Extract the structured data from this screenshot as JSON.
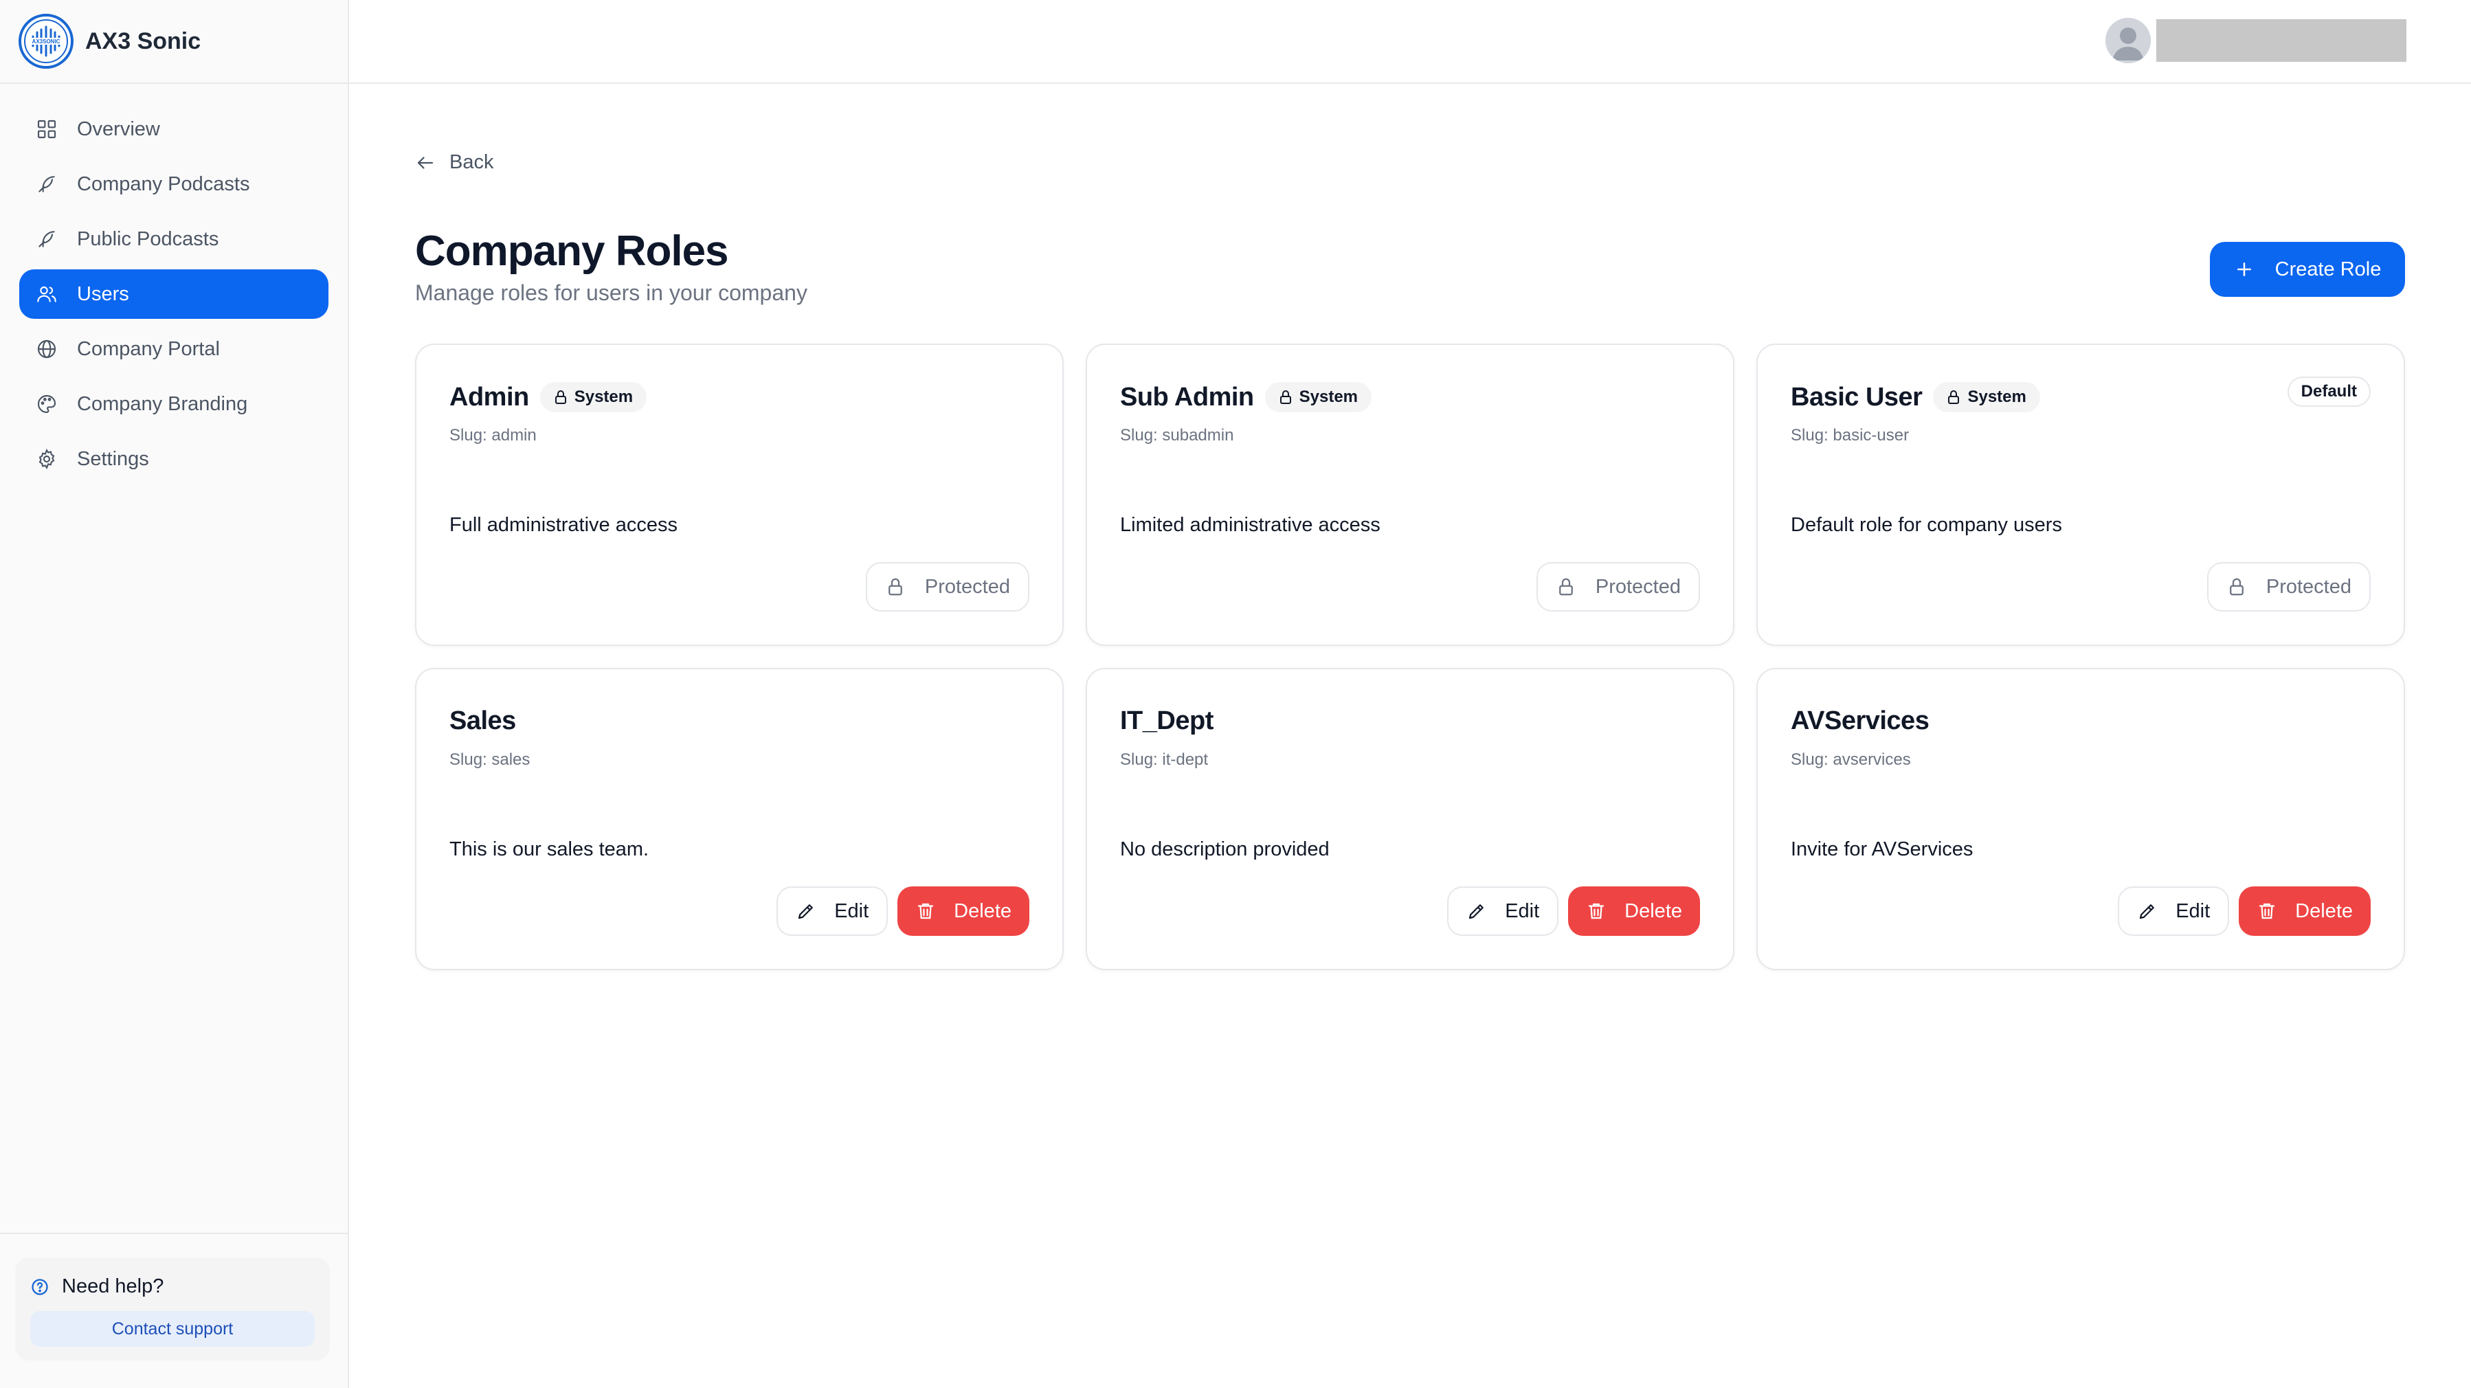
{
  "app": {
    "name": "AX3 Sonic",
    "logo_text": "AX3SONIC"
  },
  "sidebar": {
    "items": [
      {
        "label": "Overview",
        "icon": "grid-icon"
      },
      {
        "label": "Company Podcasts",
        "icon": "feather-icon"
      },
      {
        "label": "Public Podcasts",
        "icon": "feather-icon"
      },
      {
        "label": "Users",
        "icon": "users-icon",
        "active": true
      },
      {
        "label": "Company Portal",
        "icon": "globe-icon"
      },
      {
        "label": "Company Branding",
        "icon": "palette-icon"
      },
      {
        "label": "Settings",
        "icon": "gear-icon"
      }
    ],
    "help": {
      "title": "Need help?",
      "button": "Contact support"
    }
  },
  "header": {
    "user_name": ""
  },
  "page": {
    "back_label": "Back",
    "title": "Company Roles",
    "subtitle": "Manage roles for users in your company",
    "create_label": "Create Role"
  },
  "roles": [
    {
      "name": "Admin",
      "system": true,
      "system_label": "System",
      "slug": "Slug: admin",
      "description": "Full administrative access",
      "protected_label": "Protected"
    },
    {
      "name": "Sub Admin",
      "system": true,
      "system_label": "System",
      "slug": "Slug: subadmin",
      "description": "Limited administrative access",
      "protected_label": "Protected"
    },
    {
      "name": "Basic User",
      "system": true,
      "system_label": "System",
      "default_label": "Default",
      "slug": "Slug: basic-user",
      "description": "Default role for company users",
      "protected_label": "Protected"
    },
    {
      "name": "Sales",
      "system": false,
      "slug": "Slug: sales",
      "description": "This is our sales team.",
      "edit_label": "Edit",
      "delete_label": "Delete"
    },
    {
      "name": "IT_Dept",
      "system": false,
      "slug": "Slug: it-dept",
      "description": "No description provided",
      "edit_label": "Edit",
      "delete_label": "Delete"
    },
    {
      "name": "AVServices",
      "system": false,
      "slug": "Slug: avservices",
      "description": "Invite for AVServices",
      "edit_label": "Edit",
      "delete_label": "Delete"
    }
  ],
  "colors": {
    "accent": "#0b66f0",
    "danger": "#ef4444"
  }
}
